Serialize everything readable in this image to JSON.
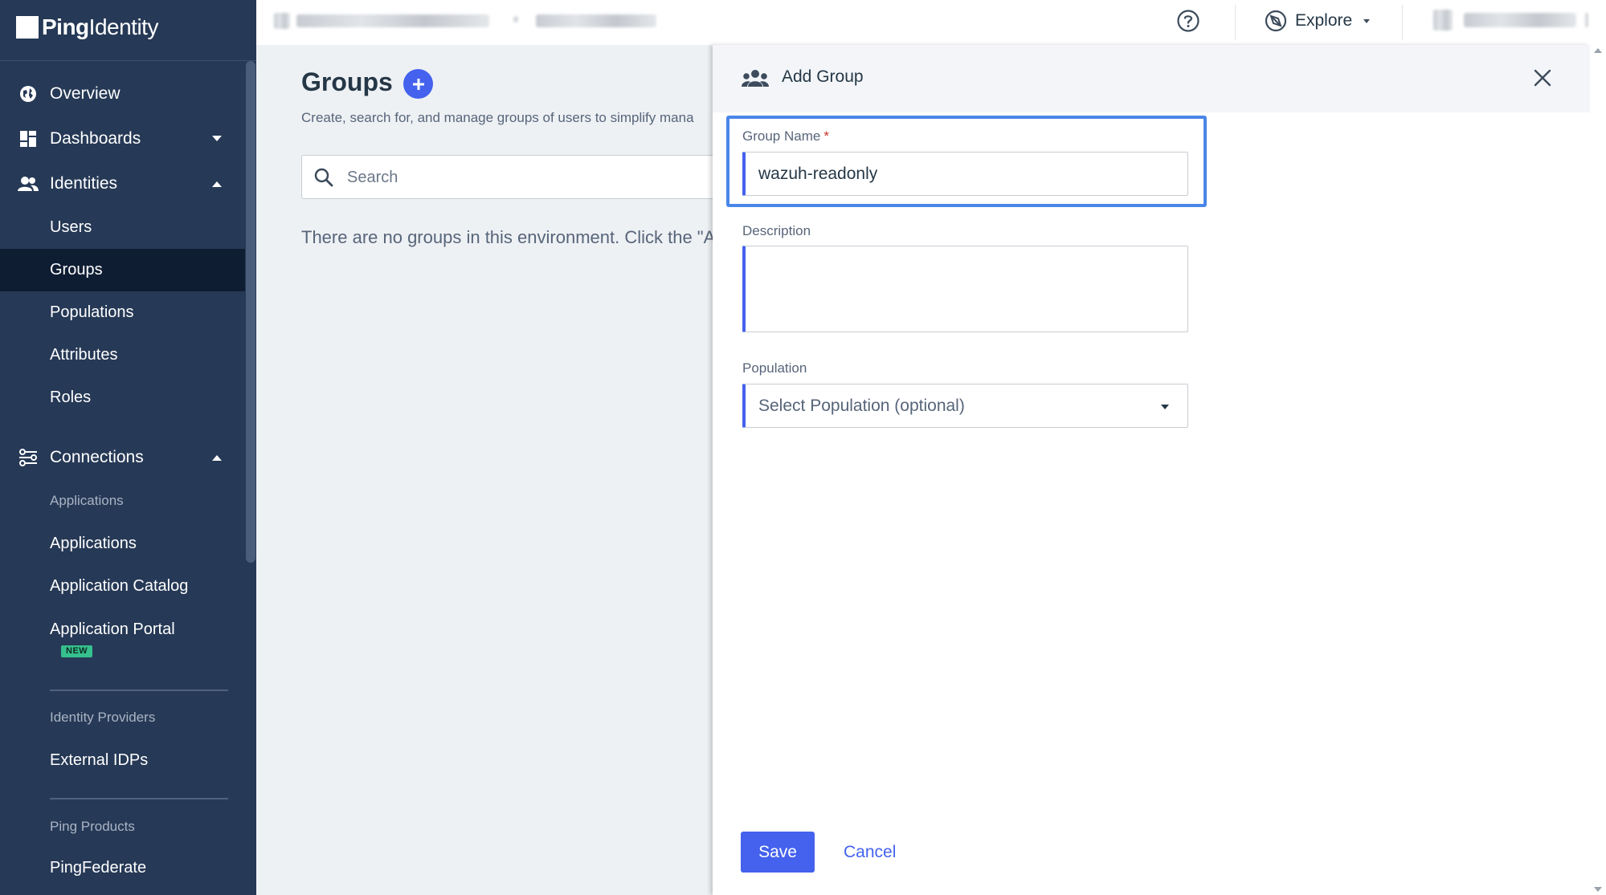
{
  "brand": {
    "name_bold": "Ping",
    "name_light": "Identity"
  },
  "sidebar": {
    "overview": "Overview",
    "dashboards": "Dashboards",
    "identities": "Identities",
    "identities_items": [
      "Users",
      "Groups",
      "Populations",
      "Attributes",
      "Roles"
    ],
    "active_item": "Groups",
    "connections": "Connections",
    "applications_heading": "Applications",
    "applications_items": [
      "Applications",
      "Application Catalog",
      "Application Portal"
    ],
    "new_badge": "NEW",
    "idp_heading": "Identity Providers",
    "idp_items": [
      "External IDPs"
    ],
    "ping_products_heading": "Ping Products",
    "ping_products_items": [
      "PingFederate"
    ]
  },
  "topbar": {
    "explore_label": "Explore",
    "help_icon": "help-circle-icon"
  },
  "main": {
    "title": "Groups",
    "description": "Create, search for, and manage groups of users to simplify mana",
    "search_placeholder": "Search",
    "empty_message": "There are no groups in this environment. Click the \"A"
  },
  "panel": {
    "title": "Add Group",
    "group_name_label": "Group Name",
    "required_marker": "*",
    "group_name_value": "wazuh-readonly",
    "description_label": "Description",
    "description_value": "",
    "population_label": "Population",
    "population_placeholder": "Select Population (optional)",
    "save_label": "Save",
    "cancel_label": "Cancel"
  },
  "colors": {
    "sidebar_bg": "#263956",
    "active_item_bg": "#0f1d33",
    "accent": "#4462ed",
    "focus_ring": "#4a86e8",
    "new_badge": "#35c08d"
  }
}
